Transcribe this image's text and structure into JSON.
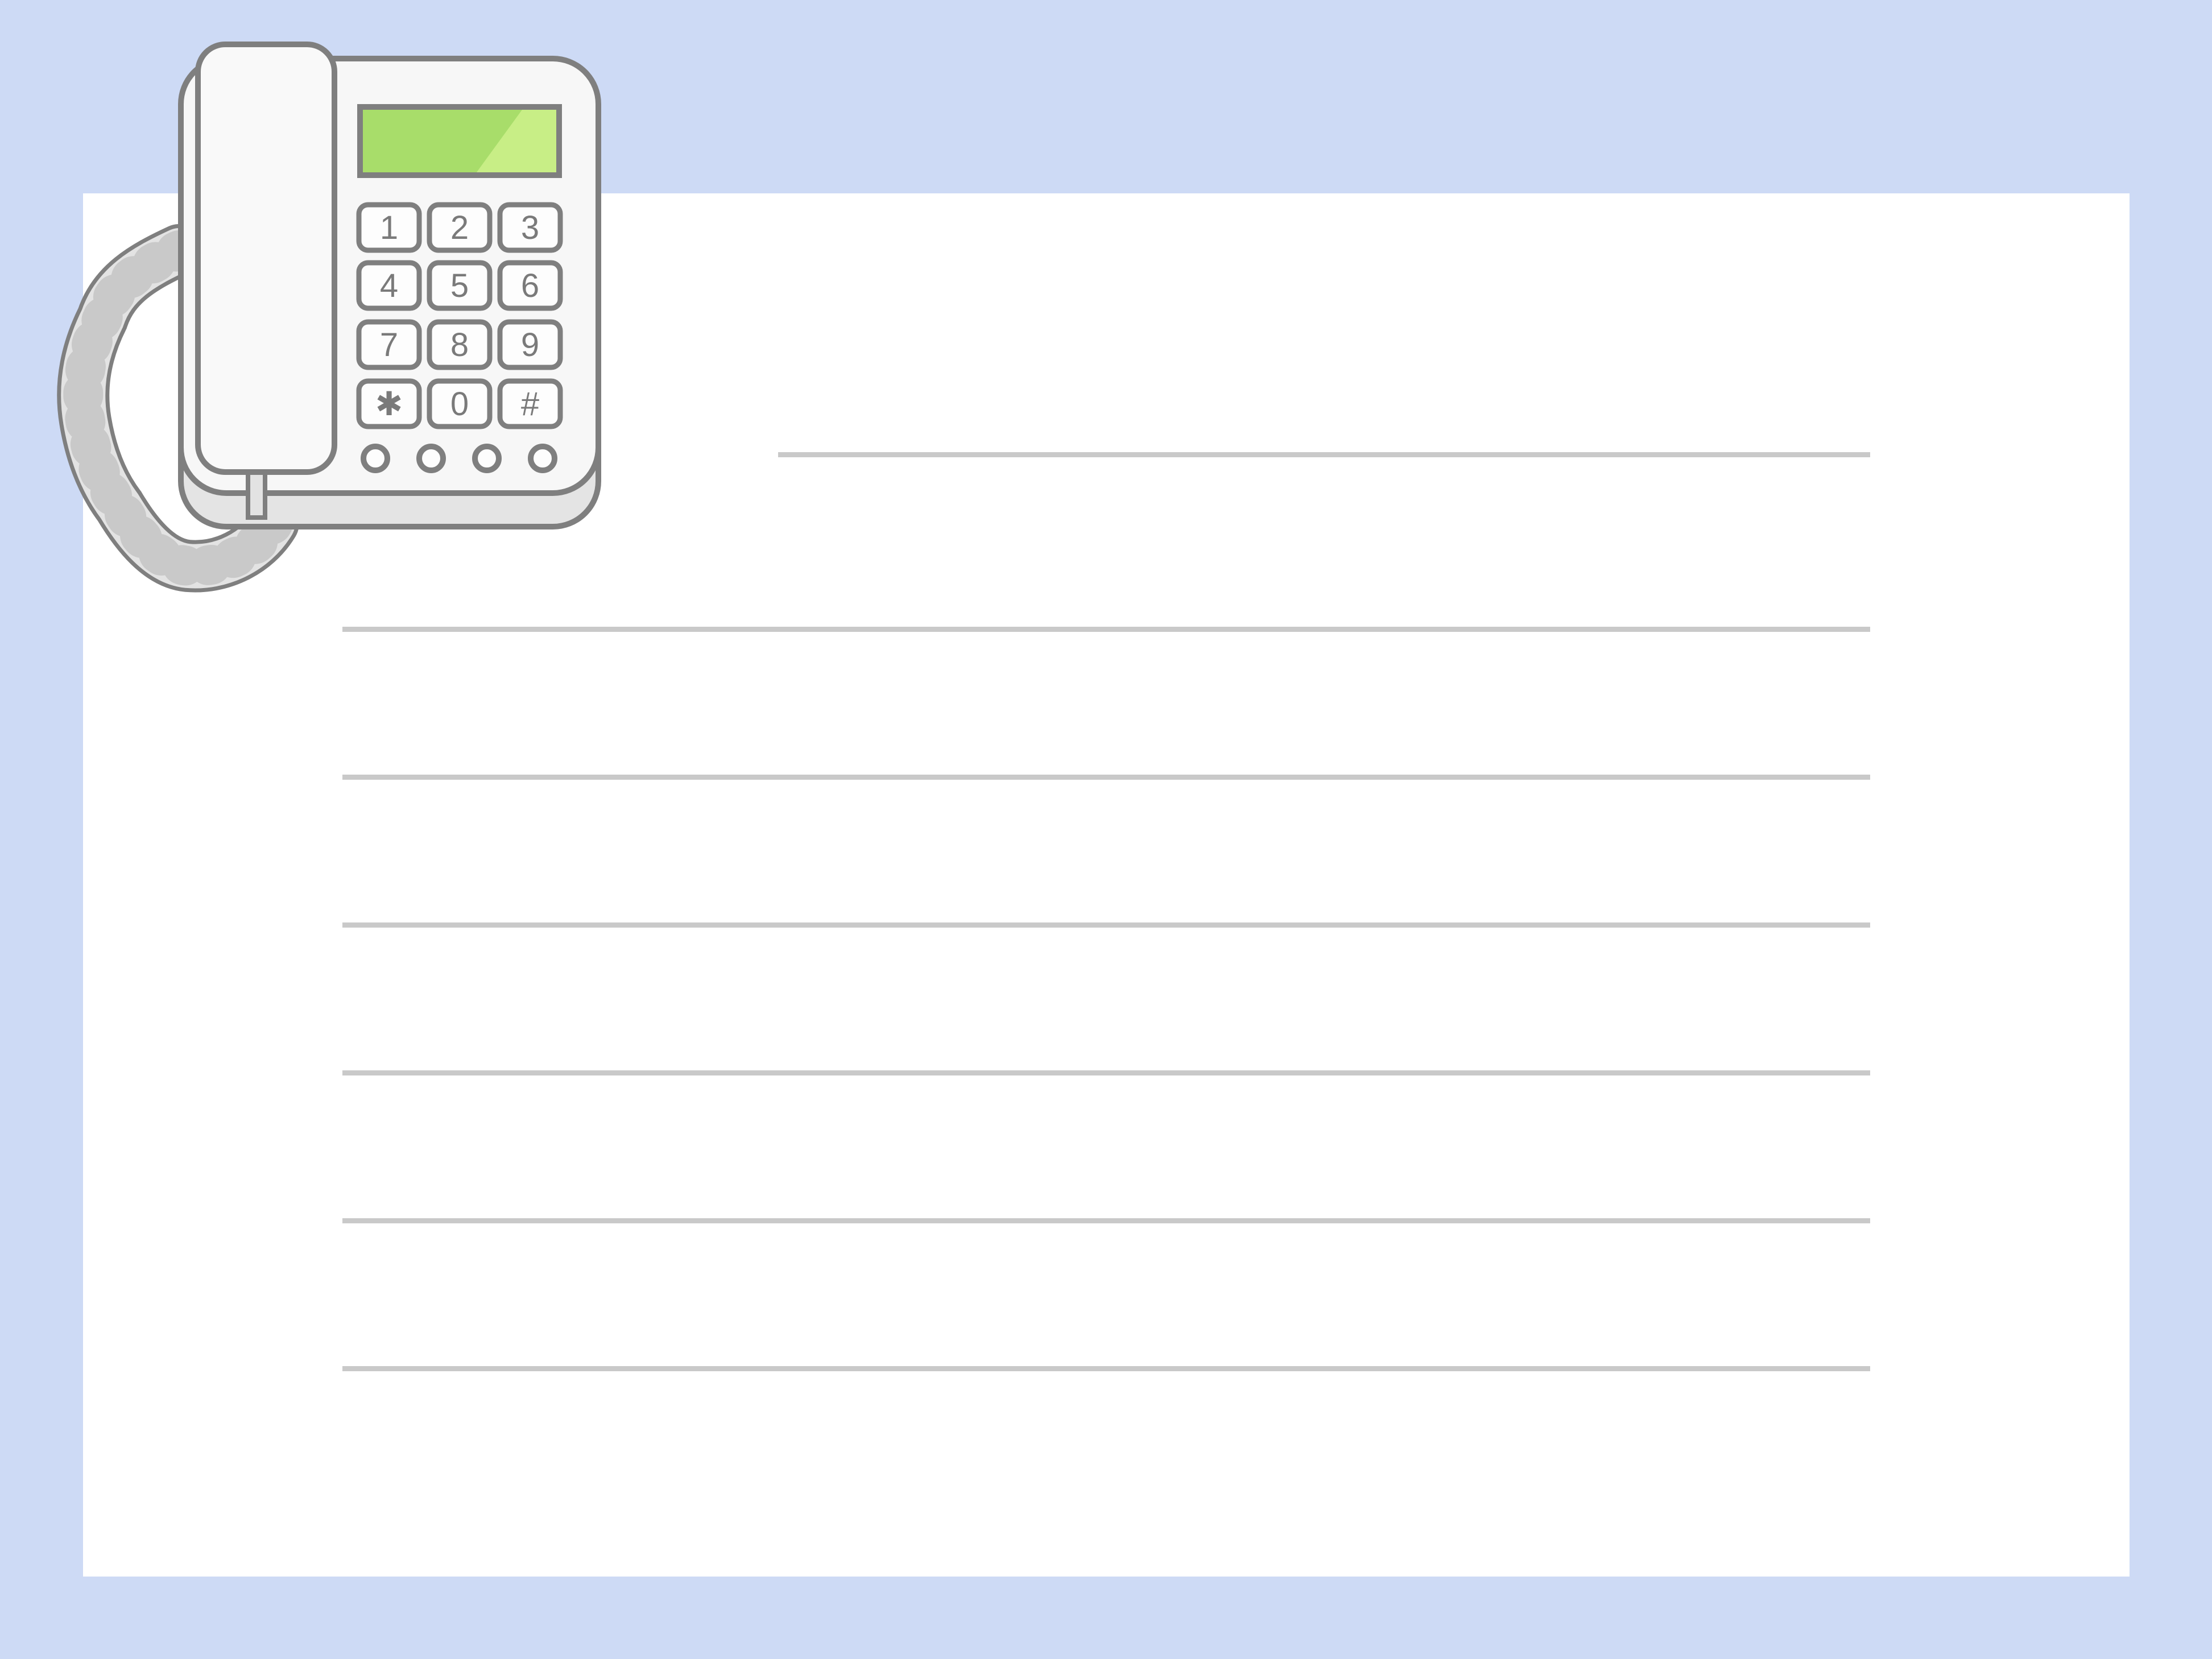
{
  "colors": {
    "frame": "#cddaf5",
    "paper": "#ffffff",
    "rule_line": "#c9c9c9",
    "phone_outline": "#7f7f7f",
    "phone_body": "#f7f7f7",
    "display_green": "#a8dd6a",
    "display_highlight": "#c8ee86"
  },
  "icons": {
    "telephone": "desk-telephone-icon",
    "cord": "coiled-cord-icon"
  },
  "keypad": {
    "rows": [
      [
        "1",
        "2",
        "3"
      ],
      [
        "4",
        "5",
        "6"
      ],
      [
        "7",
        "8",
        "9"
      ],
      [
        "✱",
        "0",
        "#"
      ]
    ]
  },
  "note": {
    "line_count": 7
  }
}
